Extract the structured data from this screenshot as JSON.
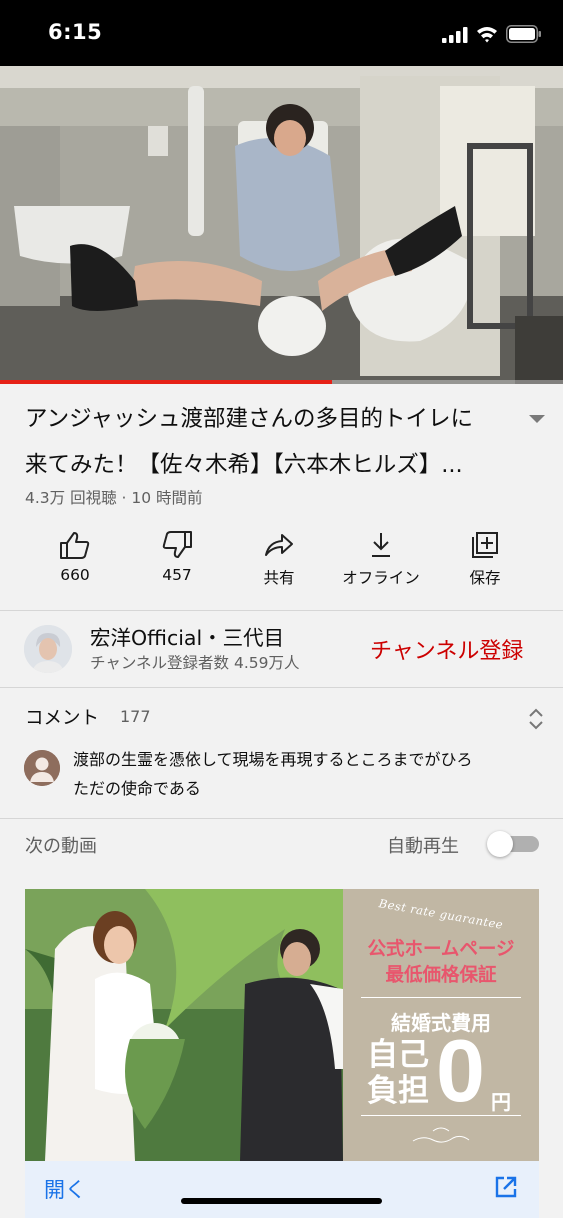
{
  "status_bar": {
    "time": "6:15"
  },
  "video": {
    "progress": 0.59,
    "colors": {
      "accent": "#e62117"
    }
  },
  "video_info": {
    "title_line1": "アンジャッシュ渡部建さんの多目的トイレに",
    "title_line2": "来てみた！【佐々木希】【六本木ヒルズ】...",
    "meta": "4.3万 回視聴 · 10 時間前"
  },
  "actions": {
    "like": {
      "label": "660",
      "icon": "thumbs-up-icon"
    },
    "dislike": {
      "label": "457",
      "icon": "thumbs-down-icon"
    },
    "share": {
      "label": "共有",
      "icon": "share-icon"
    },
    "offline": {
      "label": "オフライン",
      "icon": "download-icon"
    },
    "save": {
      "label": "保存",
      "icon": "add-to-playlist-icon"
    }
  },
  "channel": {
    "name": "宏洋Official・三代目",
    "subscribers": "チャンネル登録者数 4.59万人",
    "subscribe_label": "チャンネル登録",
    "subscribe_color": "#cc0000"
  },
  "comments": {
    "label": "コメント",
    "count": "177",
    "top_comment_line1": "渡部の生霊を憑依して現場を再現するところまでがひろ",
    "top_comment_line2": "ただの使命である"
  },
  "up_next": {
    "label": "次の動画",
    "autoplay_label": "自動再生",
    "autoplay_on": false
  },
  "ad": {
    "guarantee": "Best rate guarantee",
    "line1": "公式ホームページ",
    "line2": "最低価格保証",
    "cost_label": "結婚式費用",
    "self_pay": "自己負担",
    "zero": "0",
    "yen": "円",
    "open_label": "開く",
    "open_color": "#1a73e8"
  }
}
